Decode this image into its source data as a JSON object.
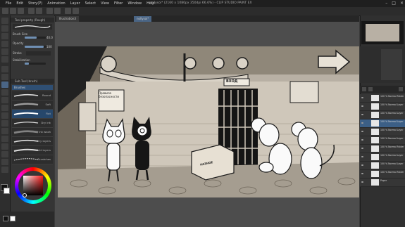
{
  "app": {
    "window_title": "nollysoi* (2160 x 1080px 350dpi 66.6%) - CLIP STUDIO PAINT EX",
    "menu": [
      "File",
      "Edit",
      "Story(P)",
      "Animation",
      "Layer",
      "Select",
      "View",
      "Filter",
      "Window",
      "Help"
    ]
  },
  "tabs": [
    {
      "label": "Illustration3"
    },
    {
      "label": "nollysoi*"
    }
  ],
  "tool_property": {
    "header": "Tool property (Rough)",
    "brush_size_label": "Brush Size",
    "brush_size_value": "40.0",
    "opacity_label": "Opacity",
    "opacity_value": "100",
    "brush_size_fraction": 0.55,
    "opacity_fraction": 0.9,
    "stroke_label": "Stroke",
    "stabilization_label": "Stabilization"
  },
  "sub_tool": {
    "header": "Sub Tool (brush)",
    "group_label": "Brushes",
    "brushes": [
      "Round",
      "Soft",
      "Flat",
      "Dry ink",
      "Ink wash",
      "Dry layers",
      "Wet layers",
      "Scratches"
    ]
  },
  "layers": [
    {
      "label": "100 % Normal Folder 1",
      "selected": false
    },
    {
      "label": "100 % Normal Layer 7",
      "selected": false
    },
    {
      "label": "100 % Normal Layer 8",
      "selected": false
    },
    {
      "label": "100 % Normal Layer 4",
      "selected": true
    },
    {
      "label": "100 % Normal Layer 5",
      "selected": false
    },
    {
      "label": "100 % Normal Layer 6",
      "selected": false
    },
    {
      "label": "100 % Normal Folder 2",
      "selected": false
    },
    {
      "label": "100 % Normal Layer 3",
      "selected": false
    },
    {
      "label": "100 % Normal Layer 2",
      "selected": false
    },
    {
      "label": "100 % Normal Folder 1",
      "selected": false
    },
    {
      "label": "Paper",
      "selected": false
    }
  ],
  "artwork": {
    "sign_left": "Правила безопасности",
    "sign_door": "ВХОД",
    "crate_label": "РАЗНОЕ"
  },
  "colors": {
    "accent": "#3c5f86",
    "canvas_bg": "#b8b0a4",
    "line": "#1b1b1b"
  }
}
